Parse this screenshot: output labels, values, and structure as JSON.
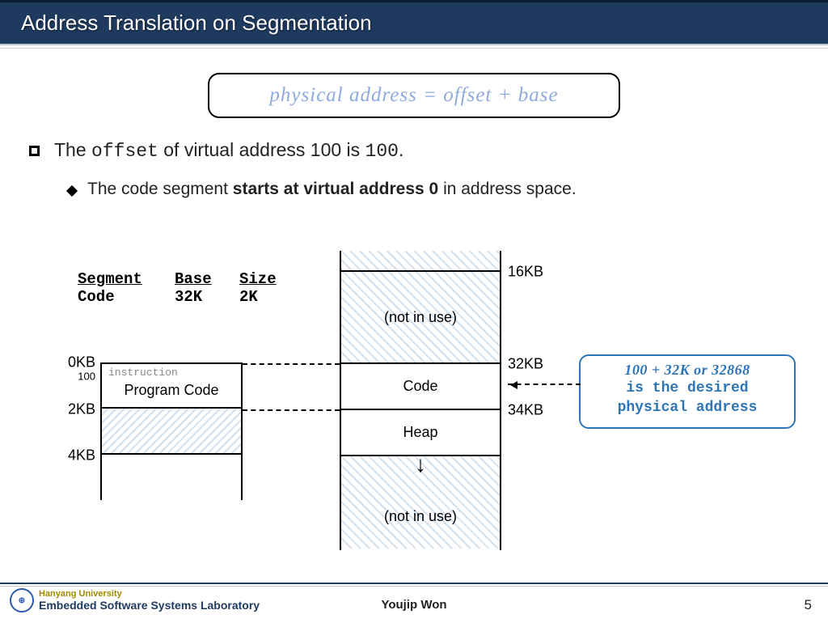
{
  "title": "Address Translation on Segmentation",
  "formula": "physical address = offset + base",
  "bullet1": {
    "pre": "The ",
    "off": "offset",
    "mid": " of virtual address 100 is ",
    "val": "100",
    "post": "."
  },
  "bullet2": {
    "pre": "The code segment ",
    "bold": "starts at virtual address 0",
    "post": " in address space."
  },
  "seg_table": {
    "h1": "Segment",
    "h2": "Base",
    "h3": "Size",
    "r1c1": "Code",
    "r1c2": "32K",
    "r1c3": "2K"
  },
  "vm": {
    "k0": "0KB",
    "k100": "100",
    "k2": "2KB",
    "k4": "4KB",
    "instr": "instruction",
    "code": "Program Code"
  },
  "pm": {
    "k16": "16KB",
    "k32": "32KB",
    "k34": "34KB",
    "notinuse": "(not in use)",
    "code": "Code",
    "heap": "Heap"
  },
  "callout": {
    "eq": "100 + 32K or 32868",
    "l2": "is the desired",
    "l3": "physical address"
  },
  "footer": {
    "uni": "Hanyang University",
    "lab": "Embedded Software Systems Laboratory",
    "author": "Youjip Won",
    "page": "5"
  }
}
